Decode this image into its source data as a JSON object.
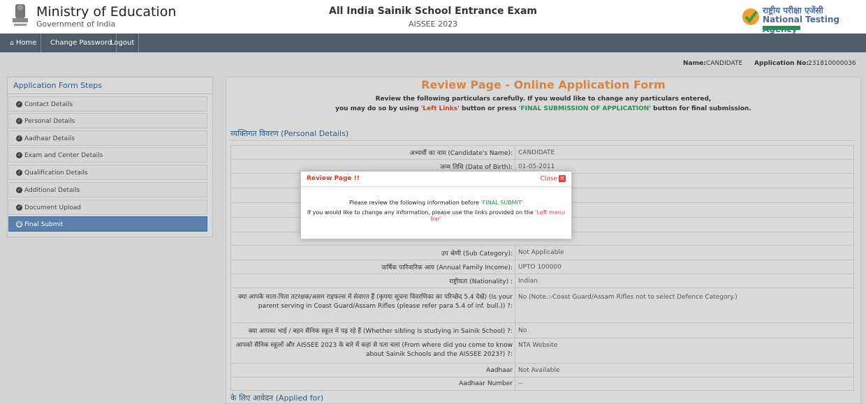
{
  "header": {
    "ministry_title": "Ministry of Education",
    "ministry_sub": "Government of India",
    "exam_title": "All India Sainik School Entrance Exam",
    "exam_sub": "AISSEE 2023",
    "nta_hindi": "राष्ट्रीय परीक्षा एजेंसी",
    "nta_english": "National Testing Agency"
  },
  "nav": {
    "home": "Home",
    "change_password": "Change Password",
    "logout": "Logout"
  },
  "userbar": {
    "name_label": "Name:",
    "name_value": "CANDIDATE",
    "app_label": "Application No:",
    "app_value": "231810000036"
  },
  "sidebar": {
    "title": "Application Form Steps",
    "items": [
      {
        "label": "Contact Details"
      },
      {
        "label": "Personal Details"
      },
      {
        "label": "Aadhaar Details"
      },
      {
        "label": "Exam and Center Details"
      },
      {
        "label": "Qualification Details"
      },
      {
        "label": "Additional Details"
      },
      {
        "label": "Document Upload"
      },
      {
        "label": "Final Submit"
      }
    ]
  },
  "main": {
    "title": "Review Page - Online Application Form",
    "instr1": "Review the following particulars carefully. If you would like to change any particulars entered,",
    "instr2_a": "you may do so by using ",
    "instr2_left": "'Left Links'",
    "instr2_b": " button or press ",
    "instr2_final": "'FINAL SUBMISSION OF APPLICATION'",
    "instr2_c": " button for final submission.",
    "section_personal_hi": "व्यक्तिगत विवरण",
    "section_personal_en": "(Personal Details)",
    "section_applied_hi": "के लिए आवेदन",
    "section_applied_en": "(Applied for)",
    "rows": [
      {
        "label": "अभ्यर्थी का नाम (Candidate's Name):",
        "value": "CANDIDATE"
      },
      {
        "label": "जन्म तिथि (Date of Birth):",
        "value": "01-05-2011"
      },
      {
        "label": "उप श्रेणी (Sub Category):",
        "value": "Not Applicable"
      },
      {
        "label": "वार्षिक पारिवारिक आय (Annual Family Income):",
        "value": "UPTO 100000"
      },
      {
        "label": "राष्ट्रीयता (Nationality) :",
        "value": "Indian"
      },
      {
        "label": "क्या आपके माता-पिता तटरक्षक/असम राइफल्स में सेवारत हैं (कृपया सूचना विवरणिका का परिच्छेद 5.4 देखें) (Is your parent serving in Coast Guard/Assam Rifles (please refer para 5.4 of inf. bull.)) ?:",
        "value": "No (Note.:-Coast Guard/Assam Rifles not to select Defence Category.)"
      },
      {
        "label": "क्या आपका भाई / बहन सैनिक स्कूल में पढ़ रहे हैं (Whether sibling is studying in Sainik School) ?:",
        "value": "No"
      },
      {
        "label": "आपको सैनिक स्कूलों और AISSEE 2023 के बारे में कहां से पता चला (From where did you come to know about Sainik Schools and the AISSEE 2023?) ?:",
        "value": "NTA Website"
      },
      {
        "label": "Aadhaar",
        "value": "Not Available"
      },
      {
        "label": "Aadhaar Number",
        "value": "--"
      }
    ]
  },
  "modal": {
    "title": "Review Page !!",
    "close": "Close",
    "line1_a": "Please review the following information before ",
    "line1_b": "'FINAL SUBMIT'",
    "line2_a": "If you would like to change any information, please use the links provided on the ",
    "line2_b": "'Left menu bar'"
  },
  "colors": {
    "nav_bg": "#4f5b66",
    "accent_orange": "#d4864a",
    "link_blue": "#2a5b88",
    "active_step": "#5b7fab"
  }
}
